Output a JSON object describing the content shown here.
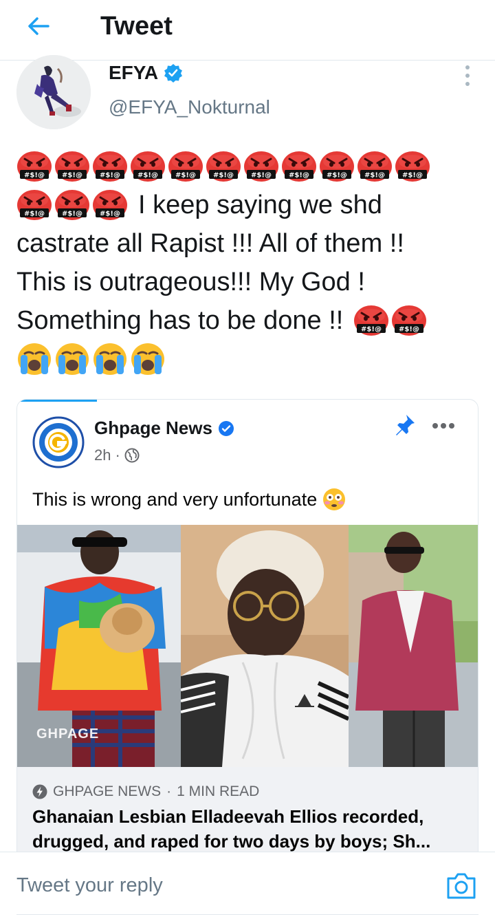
{
  "header": {
    "title": "Tweet",
    "back_icon": "arrow-left-icon"
  },
  "tweet": {
    "author_name": "EFYA",
    "verified": true,
    "handle": "@EFYA_Nokturnal",
    "text_part1": "I keep saying we shd",
    "text_part2": "castrate all Rapist !!! All of them !!",
    "text_part3": "This is outrageous!!! My God !",
    "text_part4": "Something has to be done !!",
    "emoji_cursing_face_text": "#$!@"
  },
  "embed": {
    "page_name": "Ghpage News",
    "verified": true,
    "time": "2h",
    "visibility_icon": "globe-icon",
    "post_text": "This is wrong and very unfortunate",
    "watermark": "GHPAGE",
    "source": "GHPAGE NEWS",
    "read_time": "1 MIN READ",
    "article_title": "Ghanaian Lesbian Elladeevah Ellios recorded, drugged, and raped for two days by boys; Sh..."
  },
  "reply": {
    "placeholder": "Tweet your reply"
  },
  "colors": {
    "twitter_blue": "#1da1f2",
    "facebook_blue": "#1877f2",
    "angry_red": "#e53935"
  }
}
